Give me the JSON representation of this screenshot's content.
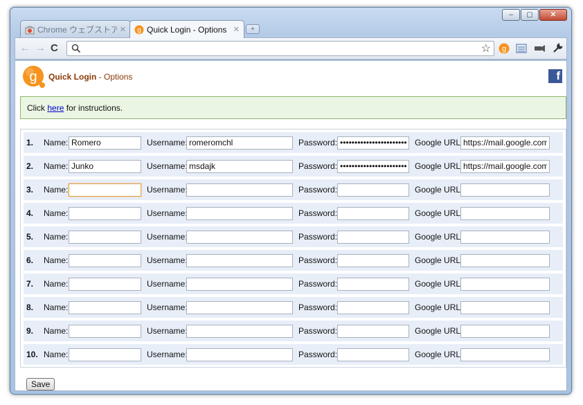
{
  "window": {
    "minimize": "–",
    "maximize": "▢",
    "close": "✕"
  },
  "tabs": [
    {
      "label": "Chrome ウェブストア - Q",
      "active": false
    },
    {
      "label": "Quick Login - Options",
      "active": true
    }
  ],
  "newtab": "+",
  "toolbar": {
    "back": "←",
    "forward": "→",
    "reload": "C",
    "star": "☆",
    "url": ""
  },
  "page": {
    "title_bold": "Quick Login",
    "title_rest": " - Options",
    "facebook": "f",
    "notice_pre": "Click ",
    "notice_link": "here",
    "notice_post": " for instructions."
  },
  "labels": {
    "name": "Name:",
    "username": "Username:",
    "password": "Password:",
    "google_url": "Google URL:"
  },
  "rows": [
    {
      "num": "1.",
      "name": "Romero",
      "username": "romeromchl",
      "password": "•••••••••••••••••••••••••",
      "google_url": "https://mail.google.com/m"
    },
    {
      "num": "2.",
      "name": "Junko",
      "username": "msdajk",
      "password": "•••••••••••••••••••••••••",
      "google_url": "https://mail.google.com/m"
    },
    {
      "num": "3.",
      "name": "",
      "username": "",
      "password": "",
      "google_url": ""
    },
    {
      "num": "4.",
      "name": "",
      "username": "",
      "password": "",
      "google_url": ""
    },
    {
      "num": "5.",
      "name": "",
      "username": "",
      "password": "",
      "google_url": ""
    },
    {
      "num": "6.",
      "name": "",
      "username": "",
      "password": "",
      "google_url": ""
    },
    {
      "num": "7.",
      "name": "",
      "username": "",
      "password": "",
      "google_url": ""
    },
    {
      "num": "8.",
      "name": "",
      "username": "",
      "password": "",
      "google_url": ""
    },
    {
      "num": "9.",
      "name": "",
      "username": "",
      "password": "",
      "google_url": ""
    },
    {
      "num": "10.",
      "name": "",
      "username": "",
      "password": "",
      "google_url": ""
    }
  ],
  "save_label": "Save",
  "colors": {
    "accent": "#f7931e",
    "notice_bg": "#eaf5e3",
    "row_bg": "#e8eef8",
    "facebook": "#3b5998"
  }
}
